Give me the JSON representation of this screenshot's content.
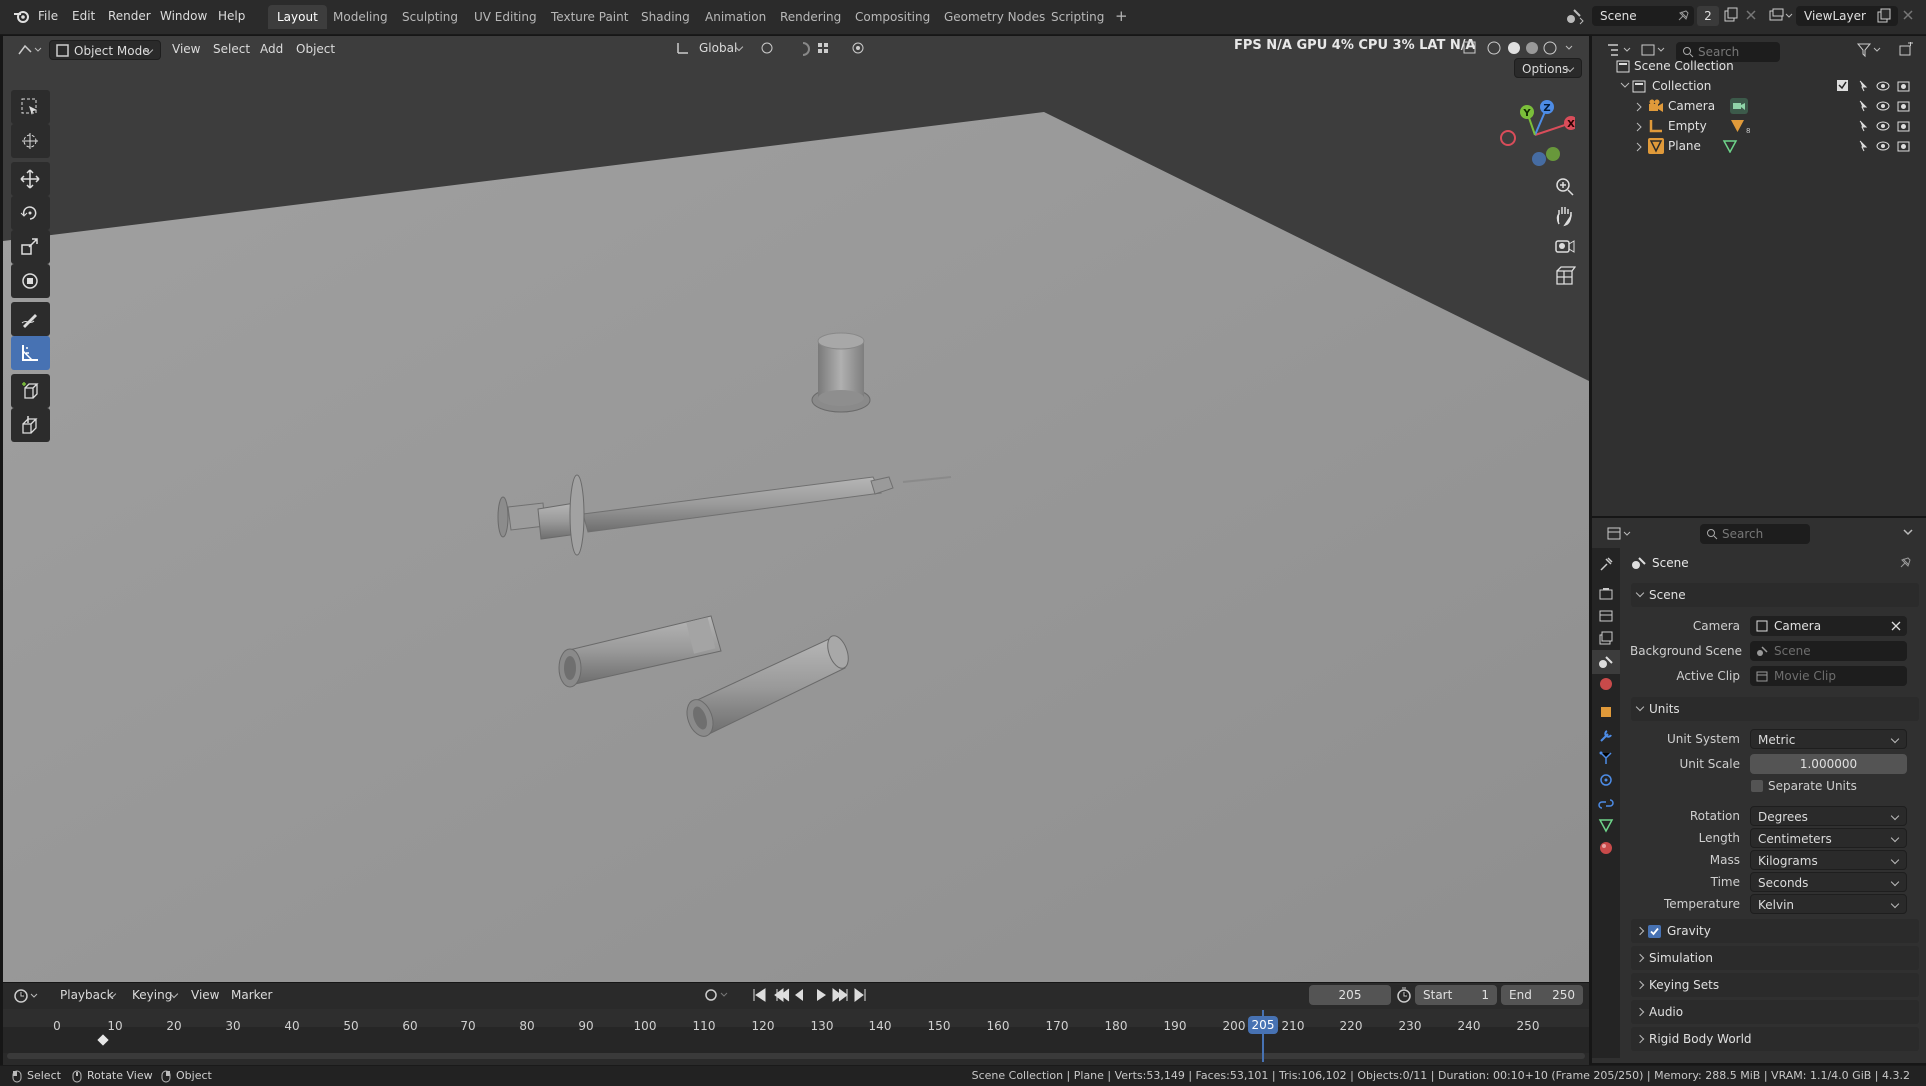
{
  "topbar": {
    "menus": [
      "File",
      "Edit",
      "Render",
      "Window",
      "Help"
    ],
    "workspaces": [
      "Layout",
      "Modeling",
      "Sculpting",
      "UV Editing",
      "Texture Paint",
      "Shading",
      "Animation",
      "Rendering",
      "Compositing",
      "Geometry Nodes",
      "Scripting"
    ],
    "active_workspace": "Layout",
    "add_tab": "+",
    "scene_name": "Scene",
    "scene_count": "2",
    "view_layer": "ViewLayer"
  },
  "viewport_header": {
    "mode": "Object Mode",
    "menus": [
      "View",
      "Select",
      "Add",
      "Object"
    ],
    "orientation": "Global",
    "hud": "FPS N/A GPU 4% CPU 3% LAT N/A",
    "options": "Options"
  },
  "outliner": {
    "search_placeholder": "Search",
    "root": "Scene Collection",
    "collection": "Collection",
    "items": [
      "Camera",
      "Empty",
      "Plane"
    ]
  },
  "properties": {
    "search_placeholder": "Search",
    "context": "Scene",
    "scene_section": "Scene",
    "camera_label": "Camera",
    "camera_value": "Camera",
    "bg_scene_label": "Background Scene",
    "bg_scene_placeholder": "Scene",
    "active_clip_label": "Active Clip",
    "active_clip_placeholder": "Movie Clip",
    "units_section": "Units",
    "unit_system_label": "Unit System",
    "unit_system": "Metric",
    "unit_scale_label": "Unit Scale",
    "unit_scale": "1.000000",
    "separate_units": "Separate Units",
    "rotation_label": "Rotation",
    "rotation": "Degrees",
    "length_label": "Length",
    "length": "Centimeters",
    "mass_label": "Mass",
    "mass": "Kilograms",
    "time_label": "Time",
    "time": "Seconds",
    "temperature_label": "Temperature",
    "temperature": "Kelvin",
    "gravity": "Gravity",
    "gravity_checked": true,
    "collapsed_sections": [
      "Simulation",
      "Keying Sets",
      "Audio",
      "Rigid Body World"
    ]
  },
  "timeline": {
    "menus": [
      "Playback",
      "Keying",
      "View",
      "Marker"
    ],
    "current_frame": "205",
    "start_label": "Start",
    "start": "1",
    "end_label": "End",
    "end": "250",
    "ticks": [
      "0",
      "10",
      "20",
      "30",
      "40",
      "50",
      "60",
      "70",
      "80",
      "90",
      "100",
      "110",
      "120",
      "130",
      "140",
      "150",
      "160",
      "170",
      "180",
      "190",
      "200",
      "205",
      "210",
      "220",
      "230",
      "240",
      "250"
    ],
    "playhead_frame": 205,
    "keyframe_frame": 8
  },
  "statusbar": {
    "hints": [
      "Select",
      "Rotate View",
      "Object"
    ],
    "info": "Scene Collection | Plane | Verts:53,149 | Faces:53,101 | Tris:106,102 | Objects:0/11 | Duration: 00:10+10 (Frame 205/250) | Memory: 288.5 MiB | VRAM: 1.1/4.0 GiB | 4.3.2"
  },
  "colors": {
    "accent": "#4772b3",
    "x_axis": "#d94d5a",
    "y_axis": "#7bbf3a",
    "z_axis": "#4d8ce6"
  }
}
